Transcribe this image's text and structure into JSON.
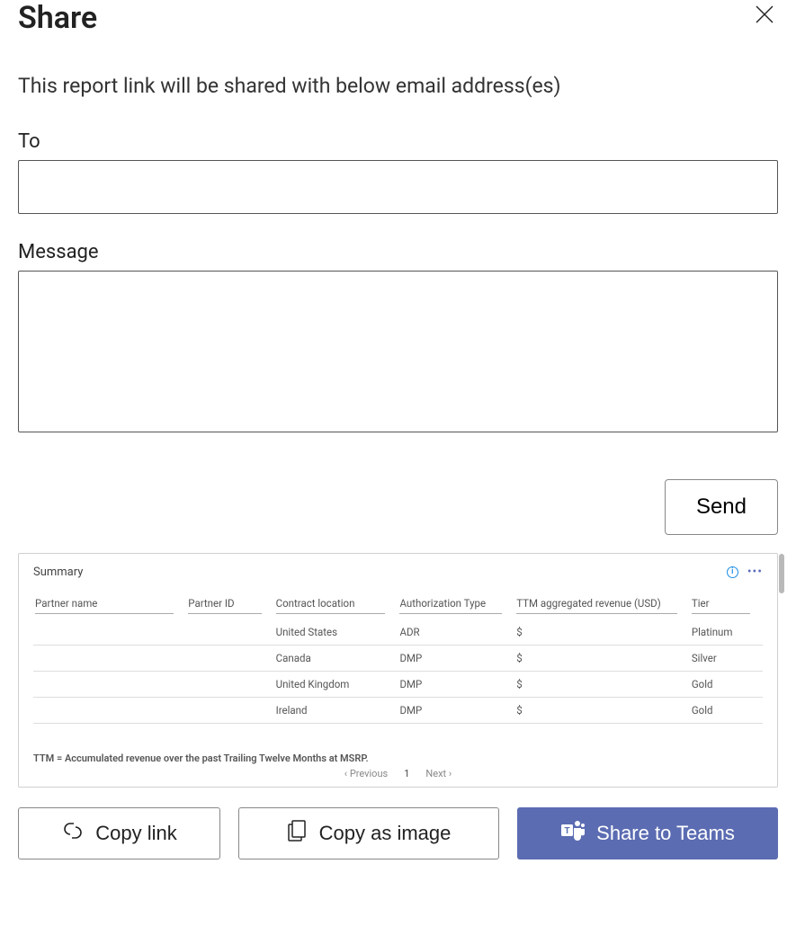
{
  "dialog": {
    "title": "Share",
    "description": "This report link will be shared with below email address(es)",
    "toLabel": "To",
    "toValue": "",
    "messageLabel": "Message",
    "messageValue": "",
    "sendLabel": "Send"
  },
  "preview": {
    "title": "Summary",
    "columns": [
      "Partner name",
      "Partner ID",
      "Contract location",
      "Authorization Type",
      "TTM aggregated revenue (USD)",
      "Tier"
    ],
    "rows": [
      {
        "partnerName": "",
        "partnerId": "",
        "contractLocation": "United States",
        "authType": "ADR",
        "ttm": "$",
        "tier": "Platinum"
      },
      {
        "partnerName": "",
        "partnerId": "",
        "contractLocation": "Canada",
        "authType": "DMP",
        "ttm": "$",
        "tier": "Silver"
      },
      {
        "partnerName": "",
        "partnerId": "",
        "contractLocation": "United Kingdom",
        "authType": "DMP",
        "ttm": "$",
        "tier": "Gold"
      },
      {
        "partnerName": "",
        "partnerId": "",
        "contractLocation": "Ireland",
        "authType": "DMP",
        "ttm": "$",
        "tier": "Gold"
      }
    ],
    "footnote": "TTM = Accumulated revenue over the past Trailing Twelve Months at MSRP.",
    "pagination": {
      "prev": "Previous",
      "next": "Next",
      "current": "1"
    }
  },
  "actions": {
    "copyLink": "Copy link",
    "copyImage": "Copy as image",
    "shareTeams": "Share to Teams"
  }
}
